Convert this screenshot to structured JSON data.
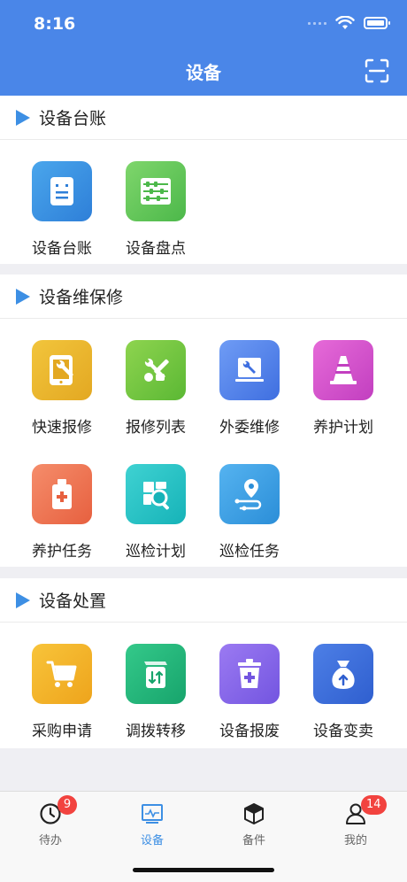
{
  "status": {
    "time": "8:16"
  },
  "header": {
    "title": "设备"
  },
  "sections": {
    "ledger": {
      "title": "设备台账",
      "items": [
        {
          "label": "设备台账",
          "icon": "ledger-doc-icon"
        },
        {
          "label": "设备盘点",
          "icon": "abacus-icon"
        }
      ]
    },
    "maintenance": {
      "title": "设备维保修",
      "items": [
        {
          "label": "快速报修",
          "icon": "tablet-wrench-icon"
        },
        {
          "label": "报修列表",
          "icon": "tools-icon"
        },
        {
          "label": "外委维修",
          "icon": "monitor-wrench-icon"
        },
        {
          "label": "养护计划",
          "icon": "traffic-cone-icon"
        },
        {
          "label": "养护任务",
          "icon": "first-aid-bottle-icon"
        },
        {
          "label": "巡检计划",
          "icon": "magnifier-icon"
        },
        {
          "label": "巡检任务",
          "icon": "location-pin-icon"
        }
      ]
    },
    "disposal": {
      "title": "设备处置",
      "items": [
        {
          "label": "采购申请",
          "icon": "shopping-cart-icon"
        },
        {
          "label": "调拨转移",
          "icon": "transfer-arrows-icon"
        },
        {
          "label": "设备报废",
          "icon": "trash-icon"
        },
        {
          "label": "设备变卖",
          "icon": "money-bag-icon"
        }
      ]
    }
  },
  "tabbar": {
    "todo": {
      "label": "待办",
      "badge": "9"
    },
    "device": {
      "label": "设备"
    },
    "parts": {
      "label": "备件"
    },
    "mine": {
      "label": "我的",
      "badge": "14"
    }
  },
  "colors": {
    "header": "#4a86e8",
    "accent": "#3d8fe4",
    "badge": "#f2433f"
  }
}
